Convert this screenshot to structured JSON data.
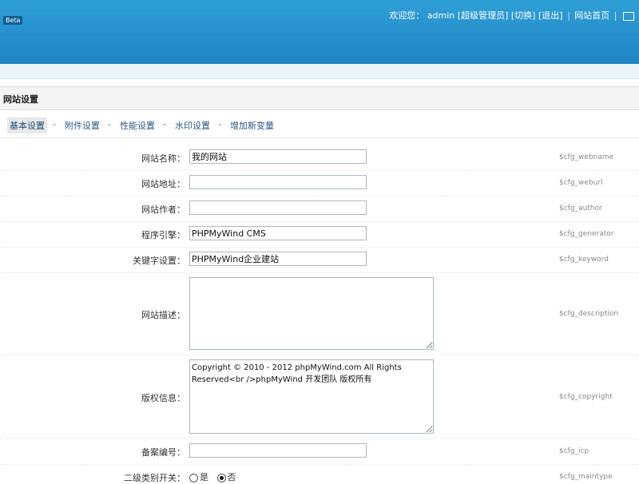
{
  "header": {
    "badge": "Beta",
    "welcome": "欢迎您：",
    "user": "admin",
    "links": [
      "[超级管理员]",
      "[切换]",
      "[退出]"
    ],
    "home": "网站首页"
  },
  "section_title": "网站设置",
  "tabs": [
    {
      "label": "基本设置",
      "active": true
    },
    {
      "label": "附件设置"
    },
    {
      "label": "性能设置"
    },
    {
      "label": "水印设置"
    },
    {
      "label": "增加新变量"
    }
  ],
  "tab_separator": "-",
  "fields": [
    {
      "label": "网站名称：",
      "value": "我的网站",
      "var": "$cfg_webname"
    },
    {
      "label": "网站地址：",
      "value": "",
      "var": "$cfg_weburl"
    },
    {
      "label": "网站作者：",
      "value": "",
      "var": "$cfg_author"
    },
    {
      "label": "程序引擎：",
      "value": "PHPMyWind CMS",
      "var": "$cfg_generator"
    },
    {
      "label": "关键字设置：",
      "value": "PHPMyWind企业建站",
      "var": "$cfg_keyword"
    },
    {
      "label": "网站描述：",
      "value": "",
      "var": "$cfg_description"
    },
    {
      "label": "版权信息：",
      "value": "Copyright © 2010 - 2012 phpMyWind.com All Rights Reserved<br />phpMyWind 开发团队 版权所有",
      "var": "$cfg_copyright"
    },
    {
      "label": "备案编号：",
      "value": "",
      "var": "$cfg_icp"
    },
    {
      "label": "二级类别开关：",
      "var": "$cfg_maintype",
      "options": [
        "是",
        "否"
      ],
      "selected": "否"
    }
  ]
}
